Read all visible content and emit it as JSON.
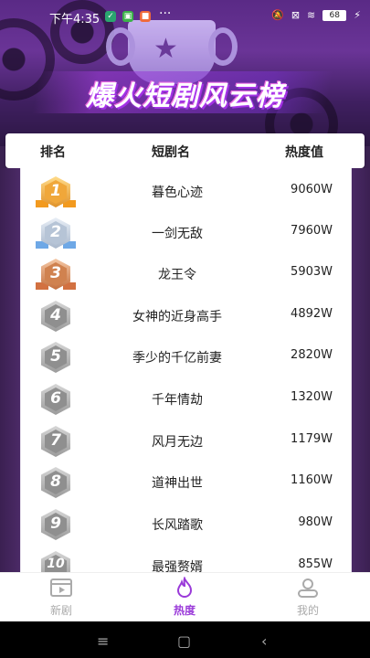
{
  "status_bar": {
    "time": "下午4:35",
    "dots": "···",
    "battery": "68"
  },
  "hero": {
    "title": "爆火短剧风云榜"
  },
  "table_header": {
    "rank": "排名",
    "drama": "短剧名",
    "heat": "热度值"
  },
  "rows": [
    {
      "rank": "1",
      "name": "暮色心迹",
      "heat": "9060W"
    },
    {
      "rank": "2",
      "name": "一剑无敌",
      "heat": "7960W"
    },
    {
      "rank": "3",
      "name": "龙王令",
      "heat": "5903W"
    },
    {
      "rank": "4",
      "name": "女神的近身高手",
      "heat": "4892W"
    },
    {
      "rank": "5",
      "name": "季少的千亿前妻",
      "heat": "2820W"
    },
    {
      "rank": "6",
      "name": "千年情劫",
      "heat": "1320W"
    },
    {
      "rank": "7",
      "name": "风月无边",
      "heat": "1179W"
    },
    {
      "rank": "8",
      "name": "道神出世",
      "heat": "1160W"
    },
    {
      "rank": "9",
      "name": "长风踏歌",
      "heat": "980W"
    },
    {
      "rank": "10",
      "name": "最强赘婿",
      "heat": "855W"
    }
  ],
  "bottom_nav": {
    "new": "新剧",
    "hot": "热度",
    "mine": "我的"
  },
  "colors": {
    "accent": "#9a3ad9",
    "inactive": "#aaaaaa"
  }
}
